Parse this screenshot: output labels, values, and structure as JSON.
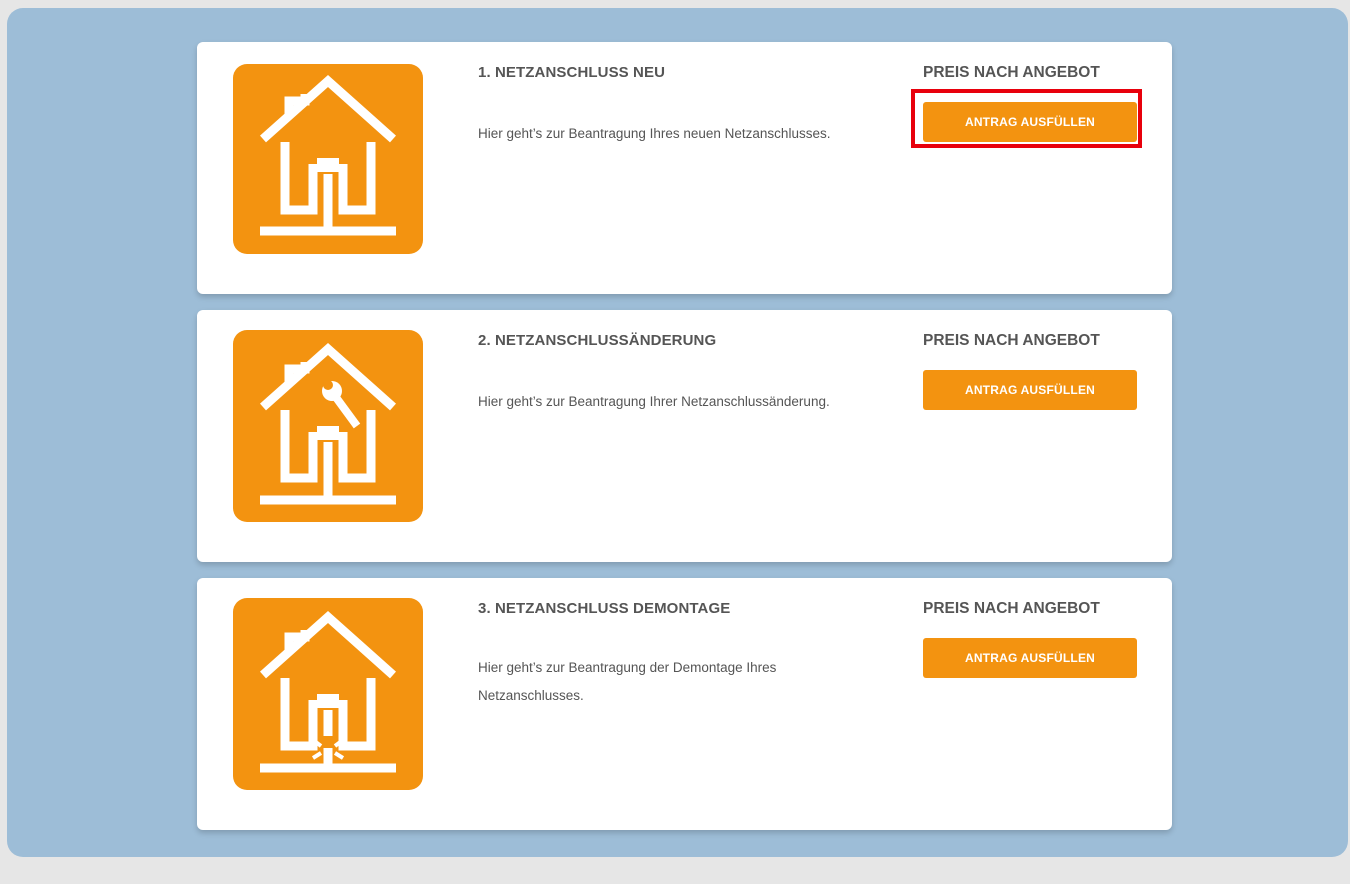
{
  "cards": [
    {
      "title": "1. NETZANSCHLUSS NEU",
      "description": "Hier geht’s zur Beantragung Ihres neuen Netzanschlusses.",
      "price": "PREIS NACH ANGEBOT",
      "button_label": "ANTRAG AUSFÜLLEN",
      "icon": "house-connection-new-icon",
      "highlighted": true
    },
    {
      "title": "2. NETZANSCHLUSSÄNDERUNG",
      "description": "Hier geht’s zur Beantragung Ihrer Netzanschlussänderung.",
      "price": "PREIS NACH ANGEBOT",
      "button_label": "ANTRAG AUSFÜLLEN",
      "icon": "house-connection-change-icon",
      "highlighted": false
    },
    {
      "title": "3. NETZANSCHLUSS DEMONTAGE",
      "description": "Hier geht’s zur Beantragung der Demontage Ihres Netzanschlusses.",
      "price": "PREIS NACH ANGEBOT",
      "button_label": "ANTRAG AUSFÜLLEN",
      "icon": "house-connection-dismantle-icon",
      "highlighted": false
    }
  ],
  "colors": {
    "accent": "#f39310",
    "panel_background": "#9dbdd7",
    "highlight_border": "#e8000c",
    "text": "#555555"
  }
}
